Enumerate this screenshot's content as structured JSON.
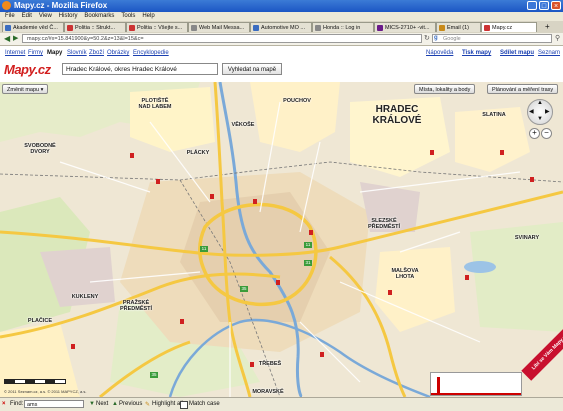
{
  "window": {
    "title": "Mapy.cz - Mozilla Firefox"
  },
  "menu": [
    "File",
    "Edit",
    "View",
    "History",
    "Bookmarks",
    "Tools",
    "Help"
  ],
  "tabs": [
    {
      "label": "Akademie věd Č..."
    },
    {
      "label": "Politia :: Strukt..."
    },
    {
      "label": "Politia :: Všejte s..."
    },
    {
      "label": "Web Mail Messa..."
    },
    {
      "label": "Automotive MO ..."
    },
    {
      "label": "Honda :: Log in"
    },
    {
      "label": "MICS-2710+ -vit..."
    },
    {
      "label": "Email (1)"
    },
    {
      "label": "Mapy.cz"
    }
  ],
  "navbar": {
    "url": "mapy.cz/#x=15.841900&y=50.2&z=13&l=15&c=",
    "search_placeholder": "Google"
  },
  "site_nav": {
    "links": [
      "Internet",
      "Firmy",
      "Mapy",
      "Slovník",
      "Zboží",
      "Obrázky",
      "Encyklopedie"
    ],
    "right_links": [
      "Nápověda",
      "Tisk mapy",
      "Sdílet mapu",
      "Seznam"
    ]
  },
  "logo": "Mapy.cz",
  "search": {
    "value": "Hradec Králové, okres Hradec Králové",
    "button": "Vyhledat na mapě"
  },
  "map_controls": {
    "change_map": "Změnit mapu",
    "places_btn": "Místa, lokality a body",
    "route_btn": "Plánování a měření trasy",
    "zoom_in": "+",
    "zoom_out": "−"
  },
  "map_labels": {
    "city": [
      "HRADEC",
      "KRÁLOVÉ"
    ],
    "places": [
      {
        "line1": "PLOTIŠTĚ",
        "line2": "NAD LABEM"
      },
      {
        "line1": "POUCHOV",
        "line2": ""
      },
      {
        "line1": "VĚKOŠE",
        "line2": ""
      },
      {
        "line1": "SLATINA",
        "line2": ""
      },
      {
        "line1": "SVOBODNÉ",
        "line2": "DVORY"
      },
      {
        "line1": "PLÁCKY",
        "line2": ""
      },
      {
        "line1": "SLEZSKÉ",
        "line2": "PŘEDMĚSTÍ"
      },
      {
        "line1": "SVINARY",
        "line2": ""
      },
      {
        "line1": "MALŠOVA",
        "line2": "LHOTA"
      },
      {
        "line1": "KUKLENY",
        "line2": ""
      },
      {
        "line1": "PRAŽSKÉ",
        "line2": "PŘEDMĚSTÍ"
      },
      {
        "line1": "PLAČICE",
        "line2": ""
      },
      {
        "line1": "TŘEBEŠ",
        "line2": ""
      },
      {
        "line1": "MORAVSKÉ",
        "line2": ""
      }
    ],
    "road_numbers": [
      "11",
      "35",
      "31",
      "11",
      "35",
      "31",
      "11",
      "35",
      "31",
      "11"
    ],
    "corner_badge": "Líbí se Vám Mapy.cz?",
    "copyright": "© 2011 Seznam.cz, a.s. © 2011 MAPYCZ, a.s."
  },
  "findbar": {
    "label": "Find:",
    "value": "ams",
    "next": "Next",
    "previous": "Previous",
    "highlight": "Highlight all",
    "match_case": "Match case"
  },
  "colors": {
    "titlebar": "#1c56c4",
    "road_major": "#f5c842",
    "road_minor": "#ffffff",
    "river": "#7aa9d8",
    "water": "#9cc3e6",
    "green": "#cfe4a6",
    "urban": "#e8d5b5",
    "industrial": "#d9c9c5",
    "marker": "#d02020",
    "logo": "#d21e1e"
  }
}
